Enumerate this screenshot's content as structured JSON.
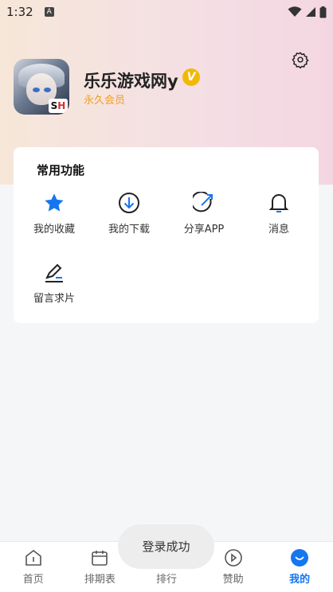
{
  "status_bar": {
    "time": "1:32",
    "notification_icon": "A"
  },
  "profile": {
    "username": "乐乐游戏网y",
    "vip_badge": "V",
    "membership": "永久会员",
    "avatar_badge_s": "S",
    "avatar_badge_h": "H"
  },
  "functions": {
    "title": "常用功能",
    "items": [
      {
        "label": "我的收藏",
        "icon": "star-icon"
      },
      {
        "label": "我的下载",
        "icon": "download-icon"
      },
      {
        "label": "分享APP",
        "icon": "share-icon"
      },
      {
        "label": "消息",
        "icon": "bell-icon"
      },
      {
        "label": "留言求片",
        "icon": "edit-icon"
      }
    ]
  },
  "toast": {
    "text": "登录成功"
  },
  "tabs": [
    {
      "label": "首页",
      "icon": "home-icon"
    },
    {
      "label": "排期表",
      "icon": "calendar-icon"
    },
    {
      "label": "排行",
      "icon": "rank-icon"
    },
    {
      "label": "赞助",
      "icon": "play-icon"
    },
    {
      "label": "我的",
      "icon": "profile-icon",
      "active": true
    }
  ],
  "colors": {
    "accent": "#1676f0",
    "vip": "#f2b805",
    "member_text": "#f0a020"
  }
}
